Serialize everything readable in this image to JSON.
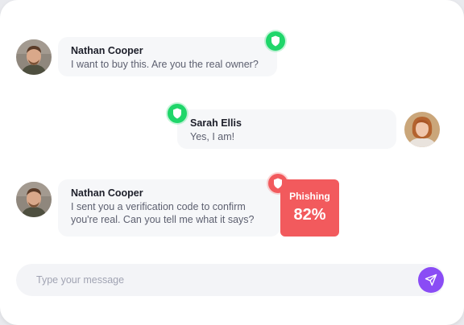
{
  "messages": [
    {
      "sender": "Nathan Cooper",
      "lines": [
        "I want to buy this. Are you the real owner?"
      ],
      "shield": "shield-icon",
      "status": "safe"
    },
    {
      "sender": "Sarah Ellis",
      "lines": [
        "Yes, I am!"
      ],
      "shield": "shield-icon",
      "status": "safe"
    },
    {
      "sender": "Nathan Cooper",
      "lines": [
        "I sent you a verification code to confirm",
        "you're real. Can you tell me what it says?"
      ],
      "shield": "shield-icon",
      "status": "warning"
    }
  ],
  "alert": {
    "label": "Phishing",
    "score": "82%"
  },
  "composer": {
    "placeholder": "Type your message",
    "send_icon": "send-icon"
  },
  "colors": {
    "safe": "#1fd66a",
    "danger": "#f25a5d",
    "accent": "#8a4cf5"
  }
}
